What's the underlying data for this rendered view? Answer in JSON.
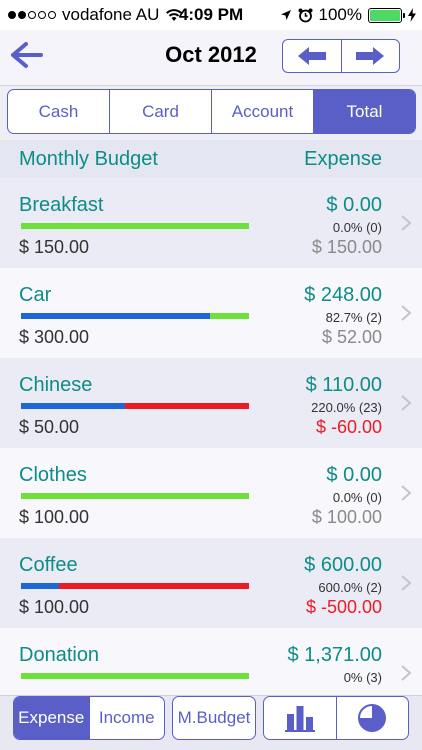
{
  "status_bar": {
    "carrier": "vodafone AU",
    "time": "4:09 PM",
    "battery": "100%",
    "signal_dots_filled": 2,
    "signal_dots_total": 5
  },
  "navbar": {
    "title": "Oct 2012",
    "back_icon": "back-arrow-icon",
    "prev_icon": "arrow-left-icon",
    "next_icon": "arrow-right-icon"
  },
  "tabs": [
    {
      "label": "Cash",
      "active": false
    },
    {
      "label": "Card",
      "active": false
    },
    {
      "label": "Account",
      "active": false
    },
    {
      "label": "Total",
      "active": true
    }
  ],
  "list_header": {
    "left": "Monthly Budget",
    "right": "Expense"
  },
  "colors": {
    "accent": "#5a5fc8",
    "teal": "#0e8c86",
    "bar_green": "#6de13a",
    "bar_blue": "#1f66d6",
    "bar_red": "#ec1c24",
    "negative": "#ec1c24"
  },
  "items": [
    {
      "name": "Breakfast",
      "expense": "$ 0.00",
      "percent": "0.0% (0)",
      "budget": "$ 150.00",
      "remaining": "$ 150.00",
      "negative": false,
      "spent_ratio": 0.0
    },
    {
      "name": "Car",
      "expense": "$ 248.00",
      "percent": "82.7% (2)",
      "budget": "$ 300.00",
      "remaining": "$ 52.00",
      "negative": false,
      "spent_ratio": 0.827
    },
    {
      "name": "Chinese",
      "expense": "$ 110.00",
      "percent": "220.0% (23)",
      "budget": "$ 50.00",
      "remaining": "$ -60.00",
      "negative": true,
      "spent_ratio": 2.2
    },
    {
      "name": "Clothes",
      "expense": "$ 0.00",
      "percent": "0.0% (0)",
      "budget": "$ 100.00",
      "remaining": "$ 100.00",
      "negative": false,
      "spent_ratio": 0.0
    },
    {
      "name": "Coffee",
      "expense": "$ 600.00",
      "percent": "600.0% (2)",
      "budget": "$ 100.00",
      "remaining": "$ -500.00",
      "negative": true,
      "spent_ratio": 6.0
    },
    {
      "name": "Donation",
      "expense": "$ 1,371.00",
      "percent": "0% (3)",
      "budget": "",
      "remaining": "",
      "negative": false,
      "spent_ratio": 0.0
    }
  ],
  "toolbar": {
    "expense_label": "Expense",
    "income_label": "Income",
    "mbudget_label": "M.Budget",
    "bar_chart_icon": "bar-chart-icon",
    "pie_chart_icon": "pie-chart-icon"
  }
}
